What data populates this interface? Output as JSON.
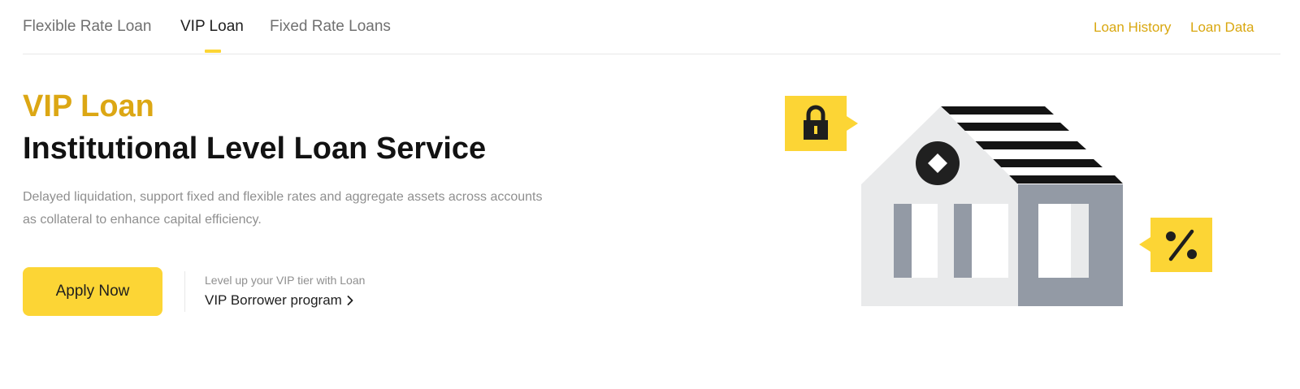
{
  "tabs": [
    {
      "label": "Flexible Rate Loan",
      "active": false
    },
    {
      "label": "VIP Loan",
      "active": true
    },
    {
      "label": "Fixed Rate Loans",
      "active": false
    }
  ],
  "header_links": {
    "loan_history": "Loan History",
    "loan_data": "Loan Data"
  },
  "hero": {
    "eyebrow": "VIP Loan",
    "title": "Institutional Level Loan Service",
    "description": "Delayed liquidation, support fixed and flexible rates and aggregate assets across accounts as collateral to enhance capital efficiency."
  },
  "actions": {
    "apply_label": "Apply Now",
    "vip_subtitle": "Level up your VIP tier with Loan",
    "vip_link": "VIP Borrower program"
  },
  "illustration": {
    "icons": [
      "lock-icon",
      "bank-building-icon",
      "percent-icon"
    ]
  },
  "colors": {
    "accent": "#fcd535",
    "accent_text": "#dca714",
    "text_primary": "#121212",
    "text_secondary": "#8f8f8f"
  }
}
